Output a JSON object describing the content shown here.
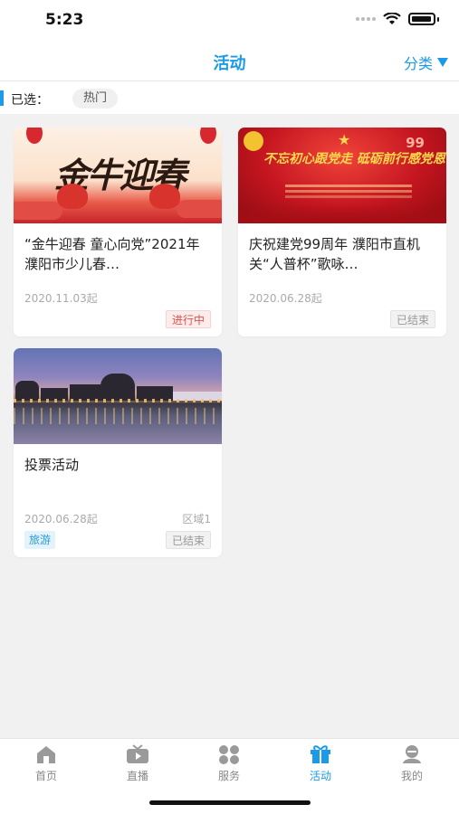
{
  "status_bar": {
    "time": "5:23"
  },
  "header": {
    "title": "活动",
    "category_label": "分类"
  },
  "filter": {
    "label": "已选：",
    "chip": "热门"
  },
  "cards": [
    {
      "title": "“金牛迎春  童心向党”2021年濮阳市少儿春…",
      "date": "2020.11.03起",
      "status": "进行中",
      "image_text": "金牛迎春"
    },
    {
      "title": "庆祝建党99周年 濮阳市直机关“人普杯”歌咏…",
      "date": "2020.06.28起",
      "status": "已结束",
      "image_text": "不忘初心跟党走 砥砺前行感党恩"
    },
    {
      "title": "投票活动",
      "date": "2020.06.28起",
      "region": "区域1",
      "tag": "旅游",
      "status": "已结束"
    }
  ],
  "tabs": [
    {
      "label": "首页",
      "icon": "home-icon"
    },
    {
      "label": "直播",
      "icon": "live-tv-icon"
    },
    {
      "label": "服务",
      "icon": "services-grid-icon"
    },
    {
      "label": "活动",
      "icon": "gift-icon",
      "active": true
    },
    {
      "label": "我的",
      "icon": "profile-icon"
    }
  ],
  "colors": {
    "accent": "#1a9ae8",
    "active_badge": "#e05050",
    "tag": "#2a9bd8"
  }
}
